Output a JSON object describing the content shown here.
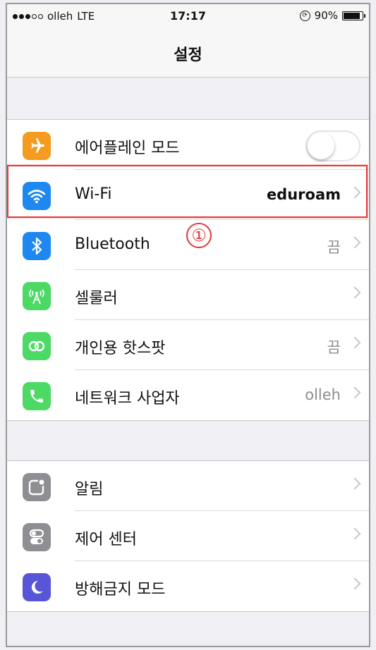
{
  "status_bar": {
    "carrier": "olleh",
    "network": "LTE",
    "time": "17:17",
    "battery": "90%",
    "signal_bars_filled": 3,
    "signal_bars_total": 5
  },
  "nav": {
    "title": "설정"
  },
  "groups": [
    {
      "rows": [
        {
          "label": "에어플레인 모드",
          "type": "toggle",
          "on": false,
          "icon": "airplane-icon",
          "color": "#f39c1f"
        },
        {
          "label": "Wi-Fi",
          "value": "eduroam",
          "type": "link",
          "icon": "wifi-icon",
          "color": "#1e88f0"
        },
        {
          "label": "Bluetooth",
          "value": "끔",
          "type": "link",
          "icon": "bluetooth-icon",
          "color": "#1e88f0"
        },
        {
          "label": "셀룰러",
          "value": "",
          "type": "link",
          "icon": "cellular-icon",
          "color": "#4cd964"
        },
        {
          "label": "개인용 핫스팟",
          "value": "끔",
          "type": "link",
          "icon": "hotspot-icon",
          "color": "#4cd964"
        },
        {
          "label": "네트워크 사업자",
          "value": "olleh",
          "type": "link",
          "icon": "phone-icon",
          "color": "#4cd964"
        }
      ]
    },
    {
      "rows": [
        {
          "label": "알림",
          "value": "",
          "type": "link",
          "icon": "notifications-icon",
          "color": "#8e8e93"
        },
        {
          "label": "제어 센터",
          "value": "",
          "type": "link",
          "icon": "control-center-icon",
          "color": "#8e8e93"
        },
        {
          "label": "방해금지 모드",
          "value": "",
          "type": "link",
          "icon": "moon-icon",
          "color": "#5856d6"
        }
      ]
    }
  ],
  "annotation": {
    "text": "①",
    "color": "#e23a3a"
  }
}
